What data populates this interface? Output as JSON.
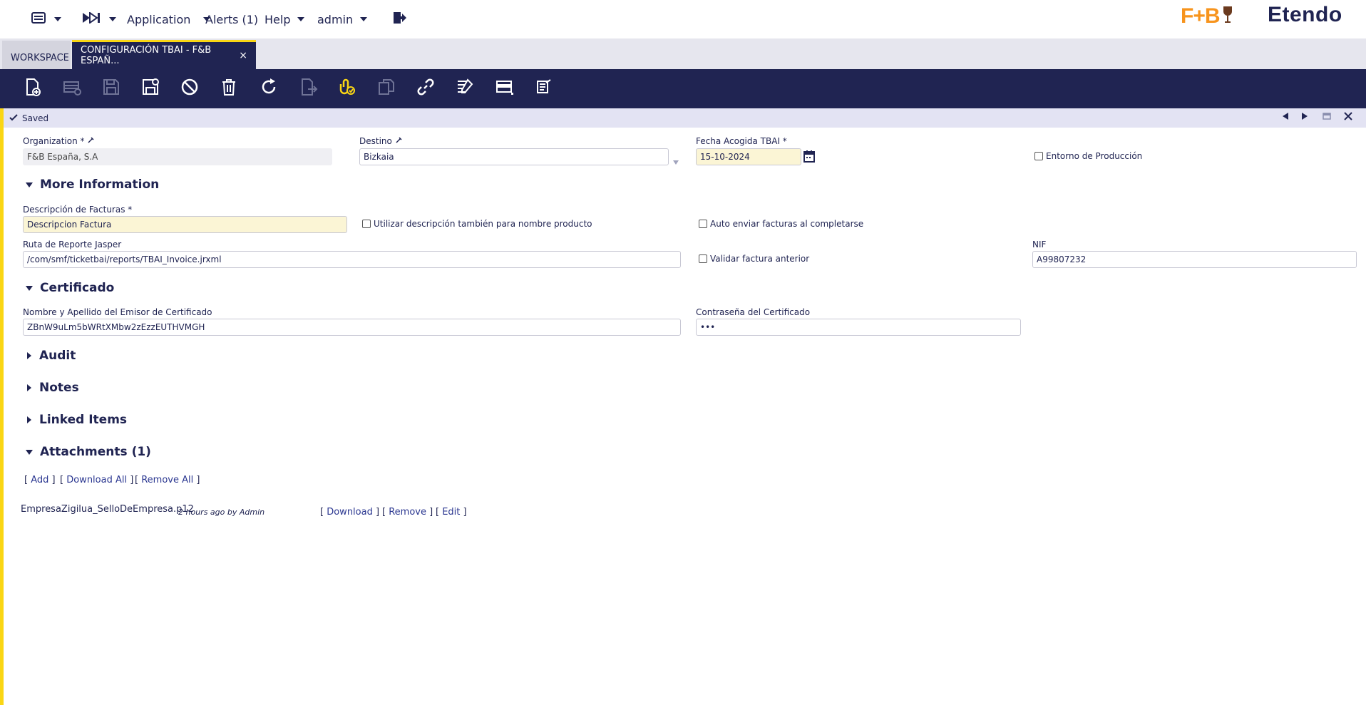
{
  "topbar": {
    "application": "Application",
    "alerts": "Alerts (1)",
    "help": "Help",
    "user": "admin",
    "brand": "F+B",
    "etendo": "Etendo"
  },
  "tabs": {
    "workspace": "WORKSPACE",
    "config": "CONFIGURACIÓN TBAI - F&B ESPAÑ...",
    "close": "×"
  },
  "status": {
    "text": "Saved"
  },
  "form": {
    "organization_label": "Organization *",
    "organization_value": "F&B España, S.A",
    "destino_label": "Destino",
    "destino_value": "Bizkaia",
    "fecha_label": "Fecha Acogida TBAI *",
    "fecha_value": "15-10-2024",
    "entorno_label": "Entorno de Producción",
    "section_more": "More Information",
    "descripcion_label": "Descripción de Facturas *",
    "descripcion_value": "Descripcion Factura",
    "utilizar_label": "Utilizar descripción también para nombre producto",
    "auto_enviar_label": "Auto enviar facturas al completarse",
    "ruta_label": "Ruta de Reporte Jasper",
    "ruta_value": "/com/smf/ticketbai/reports/TBAI_Invoice.jrxml",
    "validar_label": "Validar factura anterior",
    "nif_label": "NIF",
    "nif_value": "A99807232",
    "section_cert": "Certificado",
    "emisor_label": "Nombre y Apellido del Emisor de Certificado",
    "emisor_value": "ZBnW9uLm5bWRtXMbw2zEzzEUTHVMGH",
    "contrasena_label": "Contraseña del Certificado",
    "contrasena_value": "•••",
    "section_audit": "Audit",
    "section_notes": "Notes",
    "section_linked": "Linked Items",
    "section_attachments": "Attachments (1)"
  },
  "attachments": {
    "add": "Add",
    "download_all": "Download All",
    "remove_all": "Remove All",
    "file_name": "EmpresaZigilua_SelloDeEmpresa.p12",
    "file_meta": "2 hours ago by Admin",
    "download": "Download",
    "remove": "Remove",
    "edit": "Edit"
  },
  "colors": {
    "primary": "#202452",
    "accent": "#fad614",
    "brand_orange": "#f7941d",
    "brand_brown": "#6b3a1e"
  },
  "icons": [
    "menu-icon",
    "quick-launch-icon",
    "logout-icon",
    "new-document-icon",
    "new-row-icon",
    "save-icon",
    "save-close-icon",
    "undo-icon",
    "delete-icon",
    "refresh-icon",
    "export-icon",
    "attach-icon",
    "copy-icon",
    "link-icon",
    "audit-icon",
    "grid-view-icon",
    "print-icon",
    "calendar-icon",
    "edit-field-icon"
  ]
}
